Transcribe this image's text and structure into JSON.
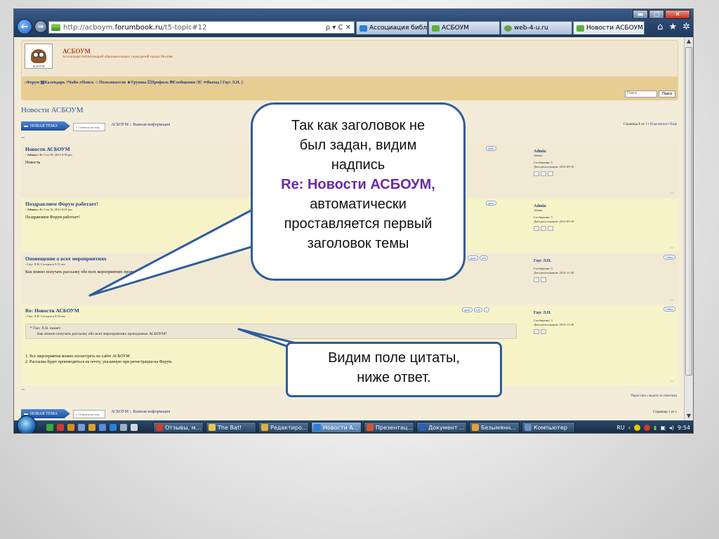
{
  "browser": {
    "url_prefix": "http://acboym.",
    "url_host": "forumbook.ru",
    "url_path": "/t5-topic#12",
    "address_tools": "ρ ▾ C ✕",
    "tabs": [
      {
        "label": "Ассоциация библио..."
      },
      {
        "label": "АСБОУМ"
      },
      {
        "label": "web-4-u.ru"
      },
      {
        "label": "Новости АСБОУМ",
        "active": true
      }
    ],
    "tab_close": "✕",
    "window_buttons": {
      "minimize": "▬",
      "maximize": "▢",
      "close": "✕"
    }
  },
  "site": {
    "title": "АСБОУМ",
    "description": "Ассоциация библиотекарей образовательных учреждений города Москвы",
    "logo_text": "АСБОУМ",
    "nav": "⌂Форум  ▤Календарь  ?ЧаВо  ⌕Поиск  ☺Пользователи  ☻Группы  ☷Профиль  ✉Сообщения ЛС  ⇦Выход [ Гаус Л.Н. ]",
    "search_placeholder": "Поиск...",
    "search_button": "Поиск"
  },
  "topic": {
    "title": "Новости АСБОУМ",
    "new_topic_label": "НОВАЯ ТЕМА",
    "reply_label": "Ответить на тему",
    "breadcrumb": "АСБОУМ :: Важная информация",
    "pages_prefix": "Страница ",
    "pages_current": "1",
    "pages_suffix": " из 1 • ",
    "share_link": "Поделиться • Ещё",
    "pages_bottom": "Страница 1 из 1",
    "unsubscribe": "Перестать следить за ответами",
    "misc": "«»"
  },
  "posts": [
    {
      "title": "Новости АСБОУМ",
      "meta_author": "Admin",
      "meta_date": " в Вт Сен 18, 2012 8:59 pm",
      "body": "Новость",
      "user": "Admin",
      "rank": "Admin",
      "stat1": "Сообщения: 5",
      "stat2": "Дата регистрации: 2012-09-18",
      "buttons": [
        "quote"
      ]
    },
    {
      "title": "Поздравляем Форум работает!",
      "meta_author": "Admin",
      "meta_date": " в Вт Сен 18, 2012 9:01 pm",
      "body": "Поздравляем Форум работает!",
      "user": "Admin",
      "rank": "Admin",
      "stat1": "Сообщения: 5",
      "stat2": "Дата регистрации: 2012-09-18",
      "buttons": [
        "quote"
      ]
    },
    {
      "title": "Оповещение о всех мероприятиях",
      "meta_author": "Гаус Л.Н.",
      "meta_date": " Сегодня в 9:51 am",
      "body": "Как можно получать рассылку обо всех мероприятиях проводимых АСБОУМ?",
      "user": "Гаус Л.Н.",
      "rank": "",
      "stat1": "Сообщения: 3",
      "stat2": "Дата регистрации: 2012-11-20",
      "buttons": [
        "quote",
        "edit"
      ],
      "online": "Online"
    },
    {
      "title": "Re: Новости АСБОУМ",
      "meta_author": "Гаус Л.Н.",
      "meta_date": " Сегодня в 9:53 am",
      "quote_cite": "Гаус Л.Н. пишет:",
      "quote_text": "Как можно получать рассылку обо всех мероприятиях проводимых АСБОУМ?",
      "body_line1": "1. Все мероприятия можно посмотреть на сайте АСБОУМ",
      "body_line2": "2. Рассылка будет производиться на почту, указанную при регистрации на Форум.",
      "user": "Гаус Л.Н.",
      "rank": "",
      "stat1": "Сообщения: 3",
      "stat2": "Дата регистрации: 2012-11-20",
      "buttons": [
        "quote",
        "edit",
        "x"
      ],
      "online": "Online"
    }
  ],
  "callouts": {
    "top_line1": "Так как заголовок не",
    "top_line2": "был задан, видим",
    "top_line3": "надпись",
    "top_highlight": "Re: Новости АСБОУМ,",
    "top_line4": "автоматически",
    "top_line5": "проставляется первый",
    "top_line6": "заголовок темы",
    "bottom_line1": "Видим поле цитаты,",
    "bottom_line2": "ниже ответ."
  },
  "taskbar": {
    "tasks": [
      {
        "label": "Отзывы, м..."
      },
      {
        "label": "The Bat!"
      },
      {
        "label": "Редактиро..."
      },
      {
        "label": "Новости А...",
        "active": true
      },
      {
        "label": "Презентац..."
      },
      {
        "label": "Документ ..."
      },
      {
        "label": "Безымянн..."
      },
      {
        "label": "Компьютер"
      }
    ],
    "lang": "RU",
    "clock": "9:54"
  },
  "colors": {
    "callout_border": "#2f5c9c",
    "highlight": "#6a2aa3",
    "link": "#1d3d8f"
  }
}
